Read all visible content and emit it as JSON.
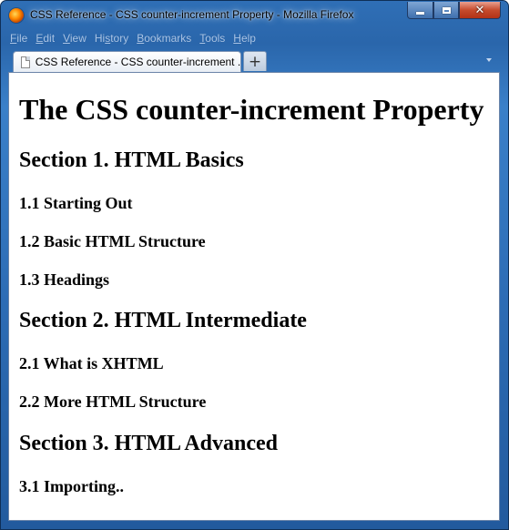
{
  "window": {
    "title": "CSS Reference - CSS counter-increment Property - Mozilla Firefox",
    "controls": {
      "minimize": "minimize",
      "maximize": "maximize",
      "close": "✕"
    }
  },
  "menu": {
    "items": [
      {
        "accel": "F",
        "rest": "ile"
      },
      {
        "accel": "E",
        "rest": "dit"
      },
      {
        "accel": "V",
        "rest": "iew"
      },
      {
        "accel": "",
        "rest": "Hi",
        "accel2": "s",
        "rest2": "tory"
      },
      {
        "accel": "B",
        "rest": "ookmarks"
      },
      {
        "accel": "T",
        "rest": "ools"
      },
      {
        "accel": "H",
        "rest": "elp"
      }
    ]
  },
  "tabs": {
    "active_label": "CSS Reference - CSS counter-increment ...",
    "new_tab": "+"
  },
  "page": {
    "heading": "The CSS counter-increment Property",
    "sections": [
      {
        "title": "Section 1. HTML Basics",
        "subsections": [
          "1.1 Starting Out",
          "1.2 Basic HTML Structure",
          "1.3 Headings"
        ]
      },
      {
        "title": "Section 2. HTML Intermediate",
        "subsections": [
          "2.1 What is XHTML",
          "2.2 More HTML Structure"
        ]
      },
      {
        "title": "Section 3. HTML Advanced",
        "subsections": [
          "3.1 Importing.."
        ]
      }
    ]
  }
}
